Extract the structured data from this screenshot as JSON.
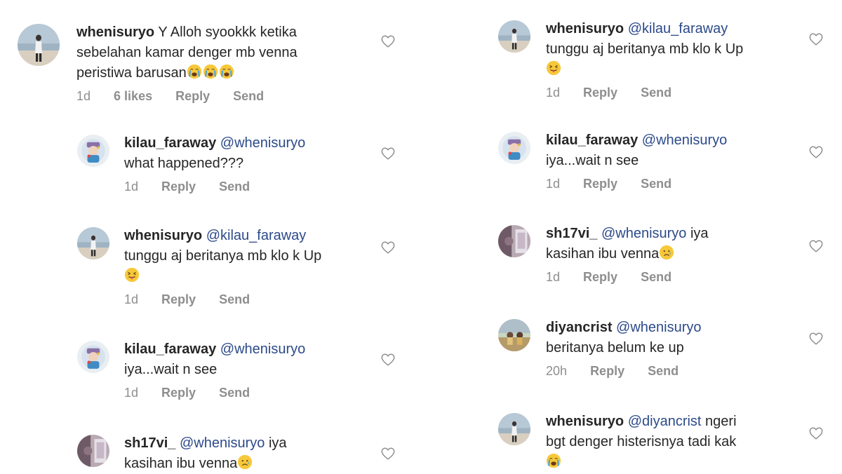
{
  "left": [
    {
      "username": "whenisuryo",
      "mention": "",
      "lines": [
        "Y Alloh syookkk ketika",
        "sebelahan kamar denger mb venna",
        "peristiwa barusan"
      ],
      "emoji": "crying-emoji x3",
      "time": "1d",
      "likes": "6 likes",
      "reply": "Reply",
      "send": "Send"
    },
    {
      "username": "kilau_faraway",
      "mention": "@whenisuryo",
      "lines": [
        "what happened???"
      ],
      "time": "1d",
      "reply": "Reply",
      "send": "Send"
    },
    {
      "username": "whenisuryo",
      "mention": "@kilau_faraway",
      "lines": [
        "tunggu aj beritanya mb klo k Up"
      ],
      "emoji": "tongue-emoji",
      "time": "1d",
      "reply": "Reply",
      "send": "Send"
    },
    {
      "username": "kilau_faraway",
      "mention": "@whenisuryo",
      "lines": [
        "iya...wait n see"
      ],
      "time": "1d",
      "reply": "Reply",
      "send": "Send"
    },
    {
      "username": "sh17vi_",
      "mention": "@whenisuryo",
      "after_mention": "iya",
      "lines": [
        "kasihan ibu venna"
      ],
      "emoji": "sad-emoji"
    }
  ],
  "right": [
    {
      "username": "whenisuryo",
      "mention": "@kilau_faraway",
      "lines": [
        "tunggu aj beritanya mb klo k Up"
      ],
      "emoji": "tongue-emoji",
      "time": "1d",
      "reply": "Reply",
      "send": "Send"
    },
    {
      "username": "kilau_faraway",
      "mention": "@whenisuryo",
      "lines": [
        "iya...wait n see"
      ],
      "time": "1d",
      "reply": "Reply",
      "send": "Send"
    },
    {
      "username": "sh17vi_",
      "mention": "@whenisuryo",
      "after_mention": "iya",
      "lines": [
        "kasihan ibu venna"
      ],
      "emoji": "sad-emoji",
      "time": "1d",
      "reply": "Reply",
      "send": "Send"
    },
    {
      "username": "diyancrist",
      "mention": "@whenisuryo",
      "lines": [
        "beritanya belum ke up"
      ],
      "time": "20h",
      "reply": "Reply",
      "send": "Send"
    },
    {
      "username": "whenisuryo",
      "mention": "@diyancrist",
      "after_mention": "ngeri",
      "lines": [
        "bgt denger histerisnya tadi kak"
      ],
      "emoji": "crying-emoji"
    }
  ],
  "colors": {
    "text": "#262626",
    "meta": "#8e8e8e",
    "mention": "#2c4a8a",
    "background": "#ffffff"
  }
}
